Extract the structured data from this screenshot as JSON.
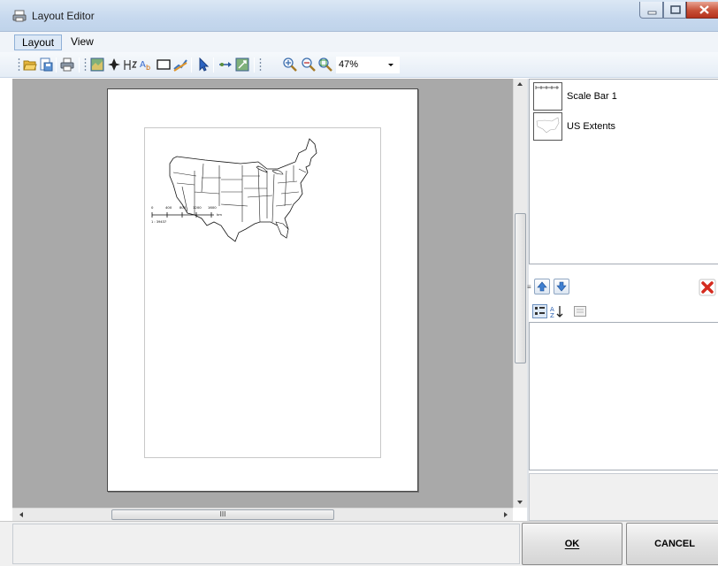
{
  "window": {
    "title": "Layout Editor",
    "controls": {
      "minimize": "minimize",
      "maximize": "maximize",
      "close": "close"
    }
  },
  "menu": {
    "items": [
      {
        "label": "Layout",
        "active": true
      },
      {
        "label": "View",
        "active": false
      }
    ]
  },
  "toolbar": {
    "icons": [
      "open-icon",
      "save-icon",
      "print-icon",
      "insert-map-icon",
      "north-arrow-icon",
      "scale-bar-icon",
      "text-icon",
      "rectangle-icon",
      "bitmap-icon",
      "select-icon",
      "pan-icon",
      "zoom-to-map-icon",
      "zoom-in-icon",
      "zoom-out-icon",
      "zoom-full-icon"
    ],
    "zoom_value": "47%"
  },
  "canvas": {
    "scale_bar": {
      "ticks": [
        "0",
        "400",
        "800",
        "1200",
        "1600"
      ],
      "unit": "km",
      "ratio": "1 : 39437"
    }
  },
  "hscroll": {
    "grip": "III"
  },
  "splitter": {
    "grip": "≡"
  },
  "elements": {
    "items": [
      {
        "label": "Scale Bar 1"
      },
      {
        "label": "US Extents"
      }
    ]
  },
  "property_toolbar": {
    "icons": [
      "categorized-icon",
      "alphabetical-icon",
      "property-pages-icon"
    ]
  },
  "buttons": {
    "ok": "OK",
    "cancel": "CANCEL"
  },
  "colors": {
    "canvas_background": "#a9a9a9",
    "title_bar": "#c6d8ee",
    "close_button": "#c75037",
    "delete_icon": "#d42b1f"
  }
}
